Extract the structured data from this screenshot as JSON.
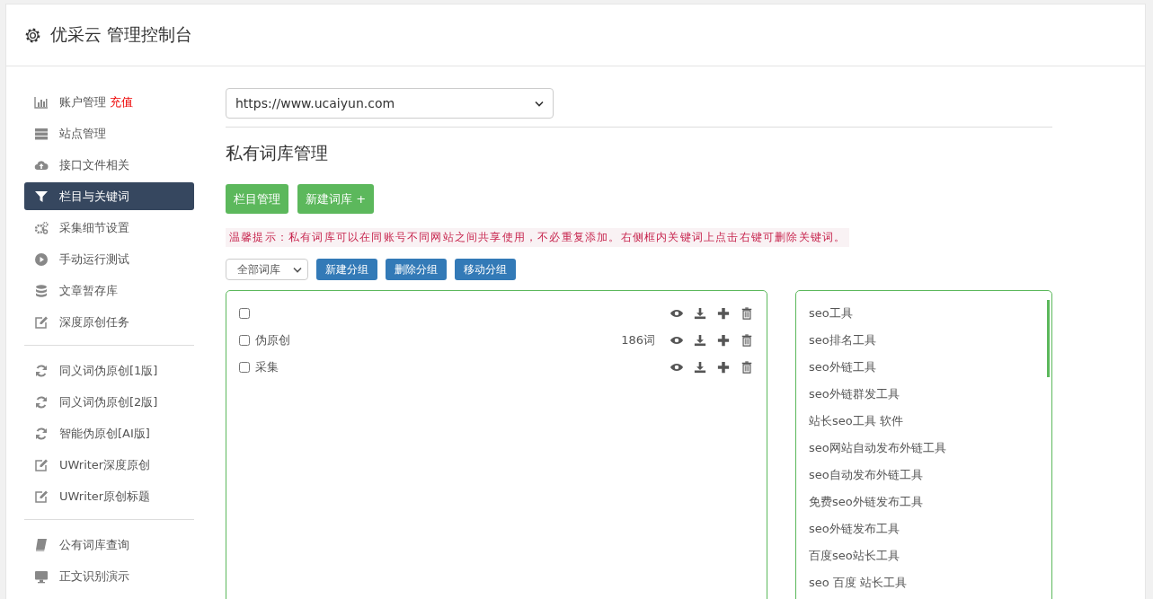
{
  "header": {
    "title": "优采云 管理控制台"
  },
  "sidebar": {
    "groups": [
      [
        {
          "label": "账户管理",
          "badge": "充值",
          "kind": "chart",
          "selected": false
        },
        {
          "label": "站点管理",
          "kind": "server",
          "selected": false
        },
        {
          "label": "接口文件相关",
          "kind": "cloud",
          "selected": false
        },
        {
          "label": "栏目与关键词",
          "kind": "filter",
          "selected": true
        },
        {
          "label": "采集细节设置",
          "kind": "gears",
          "selected": false
        },
        {
          "label": "手动运行测试",
          "kind": "play",
          "selected": false
        },
        {
          "label": "文章暂存库",
          "kind": "database",
          "selected": false
        },
        {
          "label": "深度原创任务",
          "kind": "edit",
          "selected": false
        }
      ],
      [
        {
          "label": "同义词伪原创[1版]",
          "kind": "refresh",
          "selected": false
        },
        {
          "label": "同义词伪原创[2版]",
          "kind": "refresh",
          "selected": false
        },
        {
          "label": "智能伪原创[AI版]",
          "kind": "refresh",
          "selected": false
        },
        {
          "label": "UWriter深度原创",
          "kind": "edit",
          "selected": false
        },
        {
          "label": "UWriter原创标题",
          "kind": "edit",
          "selected": false
        }
      ],
      [
        {
          "label": "公有词库查询",
          "kind": "book",
          "selected": false
        },
        {
          "label": "正文识别演示",
          "kind": "monitor",
          "selected": false
        }
      ]
    ]
  },
  "main": {
    "site_select": {
      "value": "https://www.ucaiyun.com"
    },
    "heading": "私有词库管理",
    "buttons": [
      {
        "label": "栏目管理"
      },
      {
        "label": "新建词库 +"
      }
    ],
    "tip": "温馨提示：私有词库可以在同账号不同网站之间共享使用，不必重复添加。右侧框内关键词上点击右键可删除关键词。",
    "group_select": {
      "value": "全部词库"
    },
    "group_buttons": [
      {
        "label": "新建分组"
      },
      {
        "label": "删除分组"
      },
      {
        "label": "移动分组"
      }
    ],
    "libraries": [
      {
        "checked": false
      },
      {
        "label": "伪原创",
        "count": "186词",
        "checked": false
      },
      {
        "label": "采集",
        "checked": false
      }
    ],
    "keywords": [
      "seo工具",
      "seo排名工具",
      "seo外链工具",
      "seo外链群发工具",
      "站长seo工具 软件",
      "seo网站自动发布外链工具",
      "seo自动发布外链工具",
      "免费seo外链发布工具",
      "seo外链发布工具",
      "百度seo站长工具",
      "seo 百度 站长工具"
    ]
  }
}
